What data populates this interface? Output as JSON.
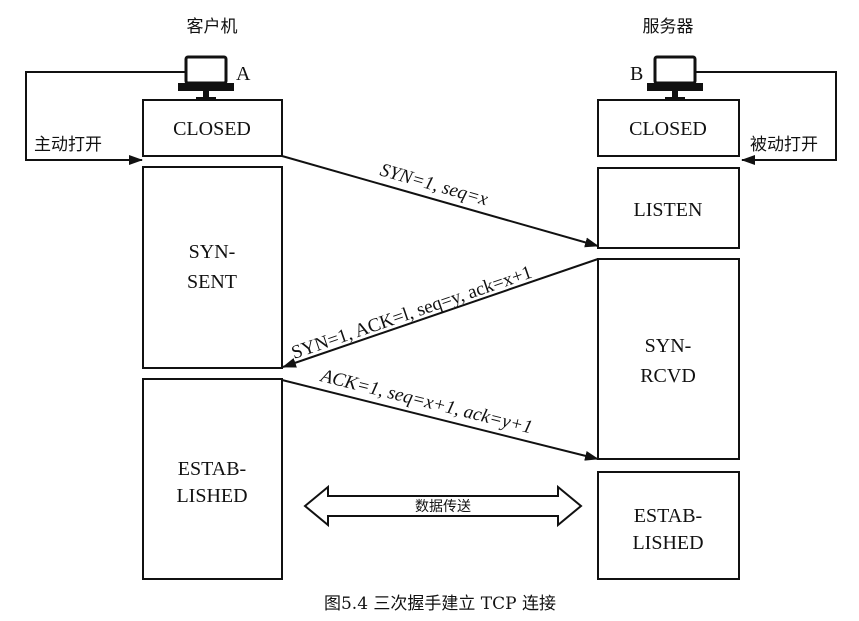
{
  "client": {
    "title": "客户机",
    "label": "A"
  },
  "server": {
    "title": "服务器",
    "label": "B"
  },
  "client_states": {
    "closed": "CLOSED",
    "syn_sent": [
      "SYN-",
      "SENT"
    ],
    "established": [
      "ESTAB-",
      "LISHED"
    ]
  },
  "server_states": {
    "closed": "CLOSED",
    "listen": "LISTEN",
    "syn_rcvd": [
      "SYN-",
      "RCVD"
    ],
    "established": [
      "ESTAB-",
      "LISHED"
    ]
  },
  "side_labels": {
    "active_open": "主动打开",
    "passive_open": "被动打开"
  },
  "messages": {
    "syn": "SYN=1, seq=x",
    "syn_ack": "SYN=1, ACK=l, seq=y,  ack=x+1",
    "ack": "ACK=1, seq=x+1, ack=y+1",
    "data_transfer": "数据传送"
  },
  "caption": "图5.4  三次握手建立 TCP 连接",
  "icons": {
    "computer": "computer-icon"
  }
}
